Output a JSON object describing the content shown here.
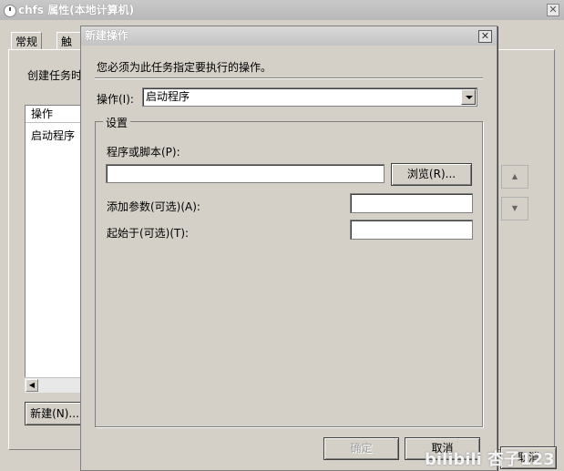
{
  "background_window": {
    "title": "chfs 属性(本地计算机)",
    "tabs": [
      "常规",
      "触发"
    ],
    "description": "创建任务时",
    "actions_list": {
      "header": "操作",
      "rows": [
        "启动程序"
      ]
    },
    "new_button": "新建(N)...",
    "cancel_button": "取消"
  },
  "dialog": {
    "title": "新建操作",
    "close_glyph": "✕",
    "instruction": "您必须为此任务指定要执行的操作。",
    "action_label": "操作(I):",
    "action_value": "启动程序",
    "settings_group": "设置",
    "program_label": "程序或脚本(P):",
    "program_value": "",
    "browse_button": "浏览(R)...",
    "args_label": "添加参数(可选)(A):",
    "args_value": "",
    "start_label": "起始于(可选)(T):",
    "start_value": "",
    "ok_button": "确定",
    "cancel_button": "取消"
  },
  "watermark": "bilibili 杏子123"
}
